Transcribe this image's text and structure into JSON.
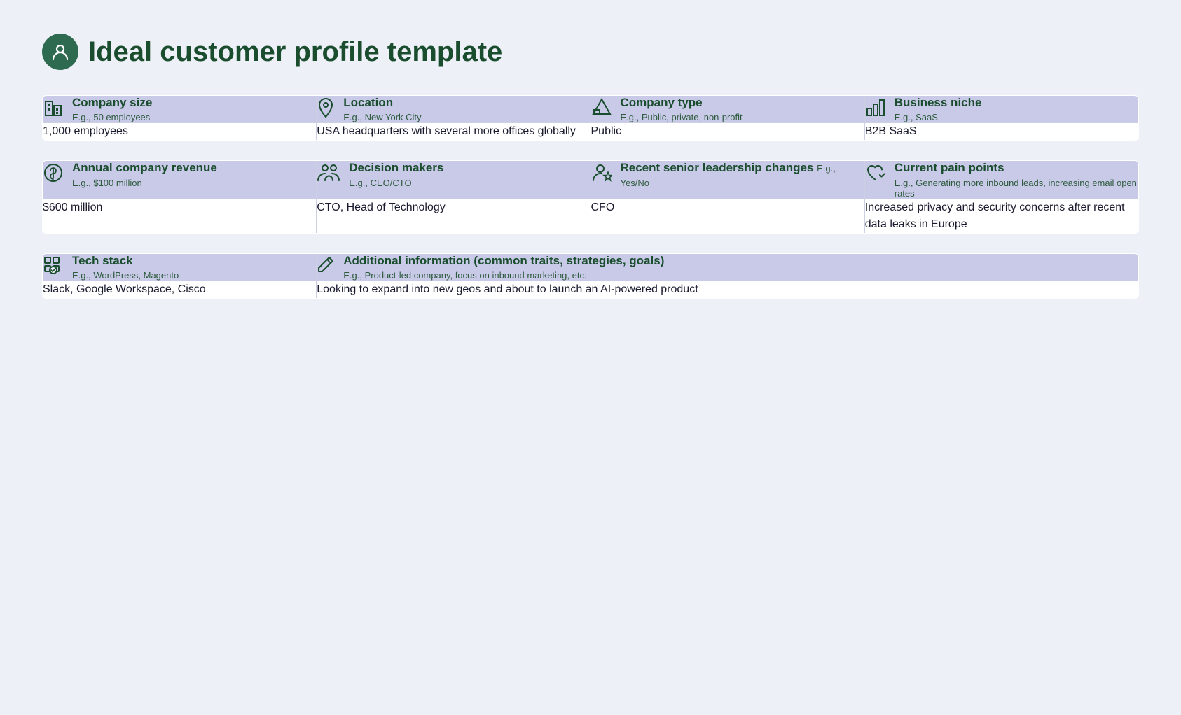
{
  "page": {
    "title": "Ideal customer profile template"
  },
  "section1": {
    "headers": [
      {
        "id": "company-size",
        "title": "Company size",
        "subtitle": "E.g., 50 employees",
        "icon": "building"
      },
      {
        "id": "location",
        "title": "Location",
        "subtitle": "E.g., New York City",
        "icon": "pin"
      },
      {
        "id": "company-type",
        "title": "Company type",
        "subtitle": "E.g., Public, private, non-profit",
        "icon": "triangle-grid"
      },
      {
        "id": "business-niche",
        "title": "Business niche",
        "subtitle": "E.g., SaaS",
        "icon": "bar-chart"
      }
    ],
    "data": [
      "1,000 employees",
      "USA headquarters with several more offices globally",
      "Public",
      "B2B SaaS"
    ]
  },
  "section2": {
    "headers": [
      {
        "id": "annual-revenue",
        "title": "Annual company revenue",
        "subtitle": "E.g., $100 million",
        "icon": "dollar"
      },
      {
        "id": "decision-makers",
        "title": "Decision makers",
        "subtitle": "E.g., CEO/CTO",
        "icon": "people"
      },
      {
        "id": "leadership-changes",
        "title": "Recent senior leadership changes",
        "subtitle": "E.g., Yes/No",
        "icon": "person-star"
      },
      {
        "id": "pain-points",
        "title": "Current pain points",
        "subtitle": "E.g., Generating more inbound leads, increasing email open rates",
        "icon": "heart-check"
      }
    ],
    "data": [
      "$600 million",
      "CTO, Head of Technology",
      "CFO",
      "Increased privacy and security concerns after recent data leaks in Europe"
    ]
  },
  "section3": {
    "headers": [
      {
        "id": "tech-stack",
        "title": "Tech stack",
        "subtitle": "E.g., WordPress, Magento",
        "icon": "grid-dots"
      },
      {
        "id": "additional-info",
        "title": "Additional information (common traits, strategies, goals)",
        "subtitle": "E.g., Product-led company, focus on inbound marketing, etc.",
        "icon": "pencil"
      }
    ],
    "data": [
      "Slack, Google Workspace, Cisco",
      "Looking to expand into new geos and about to launch an AI-powered product"
    ]
  }
}
